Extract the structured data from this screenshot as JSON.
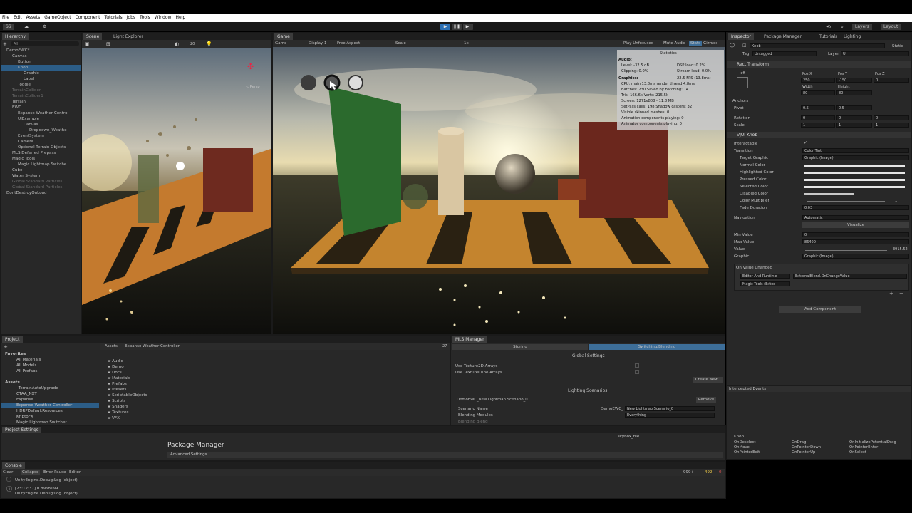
{
  "menu": [
    "File",
    "Edit",
    "Assets",
    "GameObject",
    "Component",
    "Tutorials",
    "Jobs",
    "Tools",
    "Window",
    "Help"
  ],
  "toolbar": {
    "account": "SS",
    "layers": "Layers",
    "layout": "Layout"
  },
  "hierarchy": {
    "tab": "Hierarchy",
    "search_placeholder": "All",
    "items": [
      {
        "label": "DemoEWC*",
        "indent": 0,
        "selected": false,
        "dim": false
      },
      {
        "label": "Canvas",
        "indent": 1
      },
      {
        "label": "Button",
        "indent": 2
      },
      {
        "label": "Knob",
        "indent": 2,
        "selected": true
      },
      {
        "label": "Graphic",
        "indent": 3
      },
      {
        "label": "Label",
        "indent": 3
      },
      {
        "label": "Toggle",
        "indent": 2
      },
      {
        "label": "TerrainCollider",
        "indent": 1,
        "dim": true
      },
      {
        "label": "TerrainCollider1",
        "indent": 1,
        "dim": true
      },
      {
        "label": "Terrain",
        "indent": 1
      },
      {
        "label": "EWC",
        "indent": 1
      },
      {
        "label": "Expanse Weather Contro",
        "indent": 2
      },
      {
        "label": "UIExample",
        "indent": 2
      },
      {
        "label": "Canvas",
        "indent": 3
      },
      {
        "label": "Dropdown_Weathe",
        "indent": 4
      },
      {
        "label": "EventSystem",
        "indent": 2
      },
      {
        "label": "Camera",
        "indent": 2
      },
      {
        "label": "Optional Terrain Objects",
        "indent": 2
      },
      {
        "label": "MLS Deferred Prepass",
        "indent": 1
      },
      {
        "label": "Magic Tools",
        "indent": 1
      },
      {
        "label": "Magic Lightmap Switche",
        "indent": 2
      },
      {
        "label": "Cube",
        "indent": 1
      },
      {
        "label": "Water System",
        "indent": 1
      },
      {
        "label": "Global Standard Particles",
        "indent": 1,
        "dim": true
      },
      {
        "label": "Global Standard Particles",
        "indent": 1,
        "dim": true
      },
      {
        "label": "DontDestroyOnLoad",
        "indent": 0
      }
    ]
  },
  "scene_tabs": [
    "Scene",
    "Light Explorer"
  ],
  "scene": {
    "persp": "< Persp",
    "scale_label": "20"
  },
  "game": {
    "tab": "Game",
    "display": "Display 1",
    "aspect": "Free Aspect",
    "scale_label": "Scale",
    "scale_value": "1x",
    "play_mode": "Play Unfocused",
    "mute": "Mute Audio",
    "stats": "Stats",
    "gizmos": "Gizmos",
    "dropdown": "Game"
  },
  "statistics": {
    "title": "Statistics",
    "audio": "Audio:",
    "level": "Level: -32.5 dB",
    "dsp": "DSP load: 0.2%",
    "clipping": "Clipping: 0.0%",
    "stream": "Stream load: 0.0%",
    "graphics": "Graphics:",
    "fps": "22.5 FPS (13.8ms)",
    "lines": [
      "CPU: main 13.8ms  render thread 4.8ms",
      "Batches: 230   Saved by batching: 14",
      "Tris: 166.6k    Verts: 215.5k",
      "Screen: 1271x808 - 11.8 MB",
      "SetPass calls: 198      Shadow casters: 32",
      "Visible skinned meshes: 0",
      "Animation components playing: 0",
      "Animator components playing: 0"
    ]
  },
  "inspector": {
    "tabs": [
      "Inspector",
      "Package Manager",
      "Tutorials",
      "Lighting"
    ],
    "object_name": "Knob",
    "static": "Static",
    "tag_label": "Tag",
    "tag": "Untagged",
    "layer_label": "Layer",
    "layer": "UI",
    "rect_transform": "Rect Transform",
    "left": "left",
    "pos_x_label": "Pos X",
    "pos_y_label": "Pos Y",
    "pos_z_label": "Pos Z",
    "pos_x": "250",
    "pos_y": "-150",
    "pos_z": "0",
    "width_label": "Width",
    "height_label": "Height",
    "width": "80",
    "height": "80",
    "anchors": "Anchors",
    "pivot": "Pivot",
    "pivot_x": "0.5",
    "pivot_y": "0.5",
    "rotation": "Rotation",
    "rot_x": "0",
    "rot_y": "0",
    "rot_z": "0",
    "scale": "Scale",
    "scale_x": "1",
    "scale_y": "1",
    "scale_z": "1",
    "component": "VJUI Knob",
    "interactable": "Interactable",
    "transition": "Transition",
    "transition_val": "Color Tint",
    "target_graphic": "Target Graphic",
    "target_graphic_val": "Graphic (Image)",
    "colors": [
      "Normal Color",
      "Highlighted Color",
      "Pressed Color",
      "Selected Color",
      "Disabled Color"
    ],
    "color_multiplier": "Color Multiplier",
    "color_multiplier_val": "1",
    "fade_duration": "Fade Duration",
    "fade_duration_val": "0.03",
    "navigation": "Navigation",
    "navigation_val": "Automatic",
    "visualize": "Visualize",
    "min_value": "Min Value",
    "min_value_val": "0",
    "max_value": "Max Value",
    "max_value_val": "86400",
    "value": "Value",
    "value_val": "3915.52",
    "graphic": "Graphic",
    "graphic_val": "Graphic (Image)",
    "on_value_changed": "On Value Changed",
    "runtime": "Editor And Runtime",
    "function": "ExternalBlend.OnChangeValue",
    "object_ref": "Magic Tools (Exten",
    "add_component": "Add Component",
    "intercepted": "Intercepted Events",
    "events_title": "Knob",
    "events": [
      [
        "OnDeselect",
        "OnDrag",
        "OnInitializePotentialDrag"
      ],
      [
        "OnMove",
        "OnPointerDown",
        "OnPointerEnter"
      ],
      [
        "OnPointerExit",
        "OnPointerUp",
        "OnSelect"
      ]
    ]
  },
  "project": {
    "tab": "Project",
    "favorites": "Favorites",
    "fav_items": [
      "All Materials",
      "All Models",
      "All Prefabs"
    ],
    "assets": "Assets",
    "asset_items": [
      "_TerrainAutoUpgrade",
      "CTAA_NXT",
      "Expanse",
      "Expanse Weather Controller",
      "HDRPDefaultResources",
      "KriptoFX",
      "Magic Lightmap Switcher"
    ],
    "breadcrumb_root": "Assets",
    "breadcrumb": "Expanse Weather Controller",
    "folders": [
      "Audio",
      "Demo",
      "Docs",
      "Materials",
      "Prefabs",
      "Presets",
      "ScriptableObjects",
      "Scripts",
      "Shaders",
      "Textures",
      "VFX"
    ],
    "count": "27"
  },
  "mls": {
    "tab": "MLS Manager",
    "tab_storing": "Storing",
    "tab_switching": "Switching/Blending",
    "global": "Global Settings",
    "tex2d": "Use Texture2D Arrays",
    "texcube": "Use TextureCube Arrays",
    "create_new": "Create New...",
    "lighting": "Lighting Scenarios",
    "scenario_title": "DemoEWC_New Lightmap Scenario_0",
    "remove": "Remove",
    "scenario_name_label": "Scenario Name",
    "scenario_name_a": "DemoEWC_",
    "scenario_name_b": "New Lightmap Scenario_0",
    "blending_label": "Blending Modules",
    "blending_val": "Everything",
    "cut": "Blending Blend"
  },
  "project_settings": {
    "tab": "Project Settings",
    "title": "Package Manager",
    "advanced": "Advanced Settings",
    "search": "skybox_ble"
  },
  "console": {
    "tab": "Console",
    "clear": "Clear",
    "collapse": "Collapse",
    "error_pause": "Error Pause",
    "editor": "Editor",
    "count_log": "999+",
    "count_warn": "492",
    "count_err": "0",
    "logs": [
      "UnityEngine.Debug:Log (object)",
      "[23:12:37] 0.8968199",
      "UnityEngine.Debug:Log (object)"
    ]
  },
  "colors": {
    "accent": "#2c5d87",
    "panel": "#282828",
    "highlight_tab": "#3d6e99"
  }
}
